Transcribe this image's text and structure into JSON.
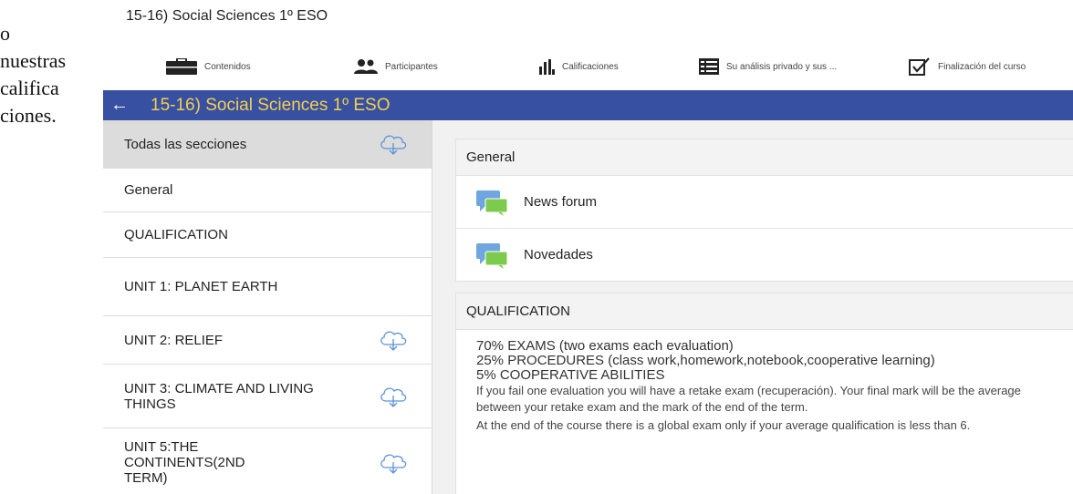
{
  "left_fragment": [
    "o",
    "nuestras",
    "califica",
    "ciones."
  ],
  "course": {
    "title": "15-16) Social Sciences 1º ESO"
  },
  "course_nav": {
    "items": [
      {
        "label": "Contenidos",
        "icon": "briefcase-icon"
      },
      {
        "label": "Participantes",
        "icon": "people-icon"
      },
      {
        "label": "Calificaciones",
        "icon": "bar-chart-icon"
      },
      {
        "label": "Su análisis privado y sus ...",
        "icon": "list-icon"
      },
      {
        "label": "Finalización del curso",
        "icon": "checkbox-icon"
      }
    ]
  },
  "app": {
    "title": "15-16) Social Sciences 1º ESO",
    "back_icon": "back-arrow-icon",
    "header_color": "#3850a2",
    "title_color": "#f2cf4d"
  },
  "sidebar": {
    "items": [
      {
        "label": "Todas las secciones",
        "download": true
      },
      {
        "label": "General",
        "download": false
      },
      {
        "label": "QUALIFICATION",
        "download": false
      },
      {
        "label": "UNIT 1: PLANET EARTH",
        "download": false
      },
      {
        "label": "UNIT 2: RELIEF",
        "download": true
      },
      {
        "label": "UNIT 3: CLIMATE AND LIVING THINGS",
        "download": true
      },
      {
        "label": "UNIT 5:THE CONTINENTS(2ND TERM)",
        "download": true
      }
    ]
  },
  "main": {
    "general": {
      "title": "General",
      "activities": [
        {
          "label": "News forum",
          "icon": "forum-icon"
        },
        {
          "label": "Novedades",
          "icon": "forum-icon"
        }
      ]
    },
    "qualification": {
      "title": "QUALIFICATION",
      "line1": "70% EXAMS (two exams each evaluation)",
      "line2": "25% PROCEDURES (class work,homework,notebook,cooperative learning)",
      "line3": "5% COOPERATIVE ABILITIES",
      "para1": "If you fail one evaluation you will have a retake exam (recuperación). Your final mark will be the average between your retake exam and the mark of the end of the term.",
      "para2": "At the end of the course there is a global exam only if your average qualification is less than 6."
    }
  }
}
